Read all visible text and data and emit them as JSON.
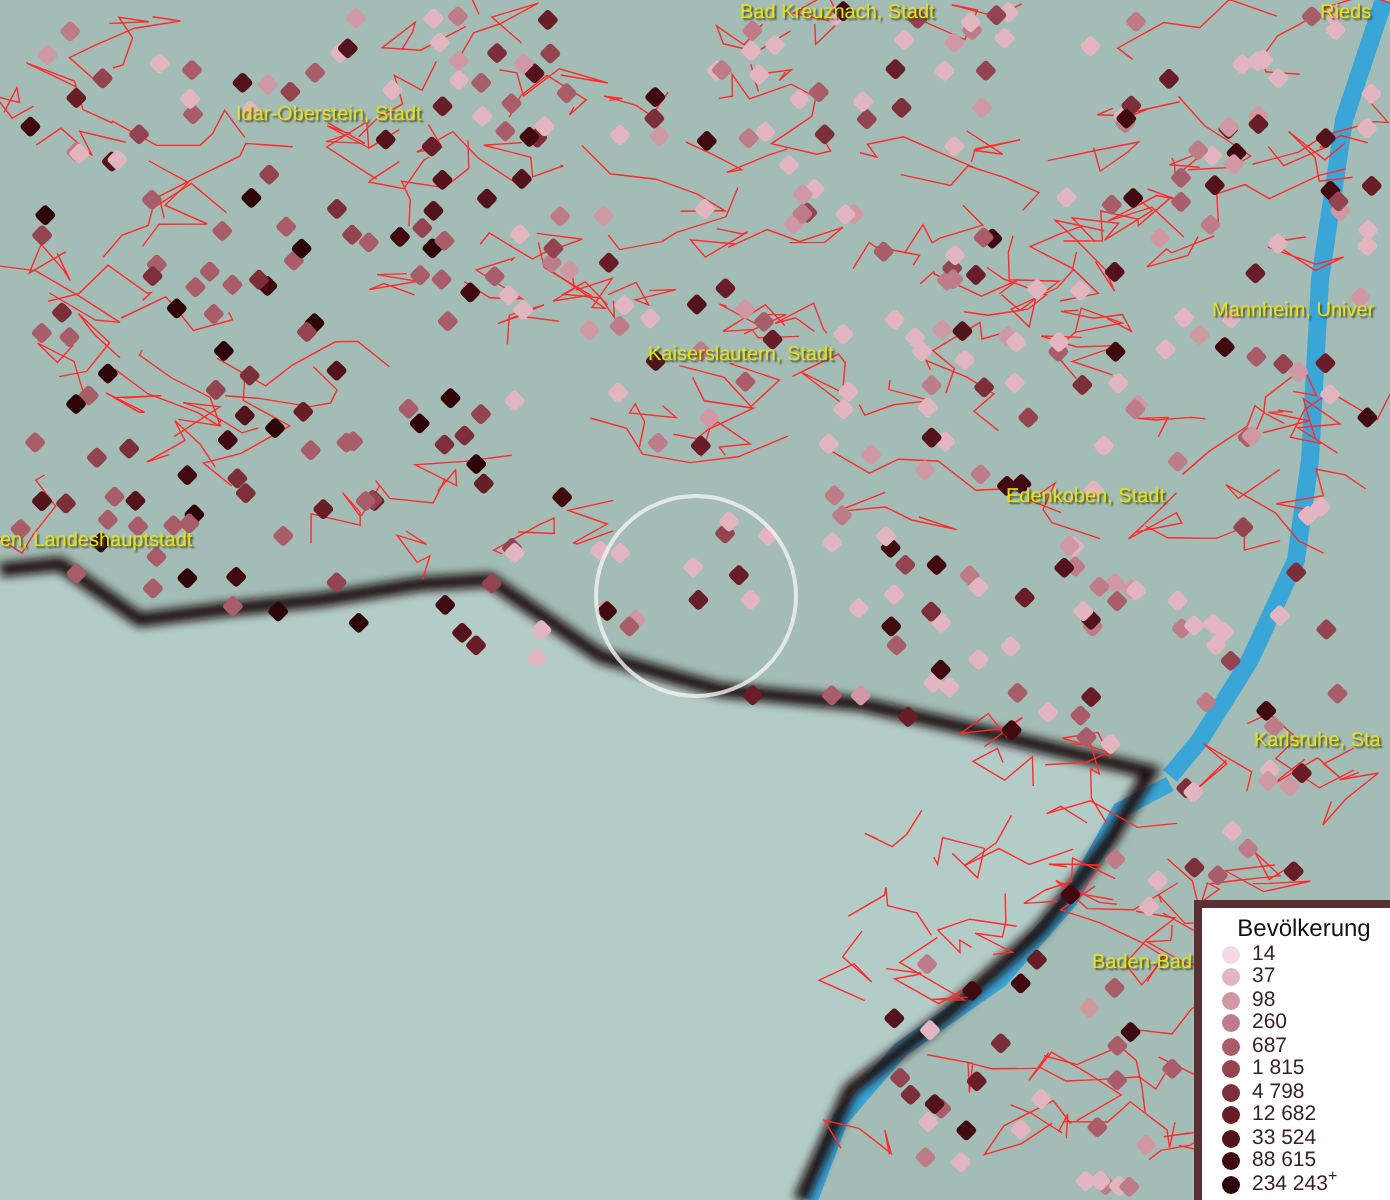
{
  "map": {
    "place_labels": [
      {
        "text": "Bad Kreuznach, Stadt"
      },
      {
        "text": "Rieds"
      },
      {
        "text": "Idar-Oberstein, Stadt"
      },
      {
        "text": "Mannheim, Univer"
      },
      {
        "text": "Kaiserslautern, Stadt"
      },
      {
        "text": "Edenkoben, Stadt"
      },
      {
        "text": "en, Landeshauptstadt"
      },
      {
        "text": "Karlsruhe, Sta"
      },
      {
        "text": "Baden-Bad"
      }
    ]
  },
  "legend": {
    "title": "Bevölkerung",
    "classes": [
      {
        "label": "14",
        "color": "#f5d8e3"
      },
      {
        "label": "37",
        "color": "#e3b5c1"
      },
      {
        "label": "98",
        "color": "#cf98a4"
      },
      {
        "label": "260",
        "color": "#bd7c87"
      },
      {
        "label": "687",
        "color": "#a85d69"
      },
      {
        "label": "1 815",
        "color": "#93444f"
      },
      {
        "label": "4 798",
        "color": "#7d2f39"
      },
      {
        "label": "12 682",
        "color": "#691e27"
      },
      {
        "label": "33 524",
        "color": "#54121a"
      },
      {
        "label": "88 615",
        "color": "#410a10"
      },
      {
        "label": "234 243$^{+}$",
        "color": "#2d0508"
      }
    ]
  }
}
